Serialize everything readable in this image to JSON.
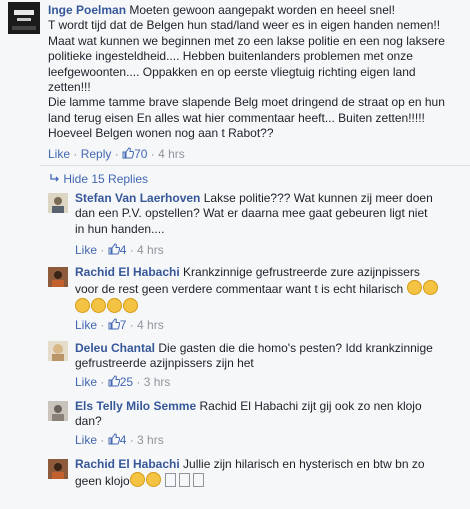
{
  "main_comment": {
    "author": "Inge Poelman",
    "lines": [
      "Moeten gewoon aangepakt worden en heeel snel!",
      "T wordt tijd dat de Belgen hun stad/land weer es in eigen handen nemen!!",
      "Maat wat kunnen we beginnen met zo een lakse politie en een nog laksere",
      "politieke ingesteldheid.... Hebben buitenlanders problemen met onze",
      "leefgewoonten.... Oppakken en op eerste vliegtuig richting eigen land",
      "zetten!!!",
      "Die lamme tamme brave slapende Belg moet dringend de straat op en hun",
      "land terug eisen En alles wat hier commentaar heeft... Buiten zetten!!!!!",
      "Hoeveel Belgen wonen nog aan t Rabot??"
    ],
    "like": "Like",
    "reply": "Reply",
    "likes": "70",
    "time": "4 hrs",
    "dot": "·"
  },
  "hide_replies": "Hide 15 Replies",
  "replies": [
    {
      "author": "Stefan Van Laerhoven",
      "lines": [
        "Lakse politie??? Wat kunnen zij meer doen",
        "dan een P.V. opstellen? Wat er daarna mee gaat gebeuren ligt niet",
        "in hun handen...."
      ],
      "like": "Like",
      "likes": "4",
      "time": "4 hrs"
    },
    {
      "author": "Rachid El Habachi",
      "lines": [
        "Krankzinnige gefrustreerde zure azijnpissers",
        "voor de rest geen verdere commentaar want t is echt hilarisch"
      ],
      "like": "Like",
      "likes": "7",
      "time": "4 hrs"
    },
    {
      "author": "Deleu Chantal",
      "lines": [
        "Die gasten die die homo's pesten? Idd krankzinnige",
        "gefrustreerde azijnpissers zijn het"
      ],
      "like": "Like",
      "likes": "25",
      "time": "3 hrs"
    },
    {
      "author": "Els Telly Milo Semme",
      "lines": [
        "Rachid El Habachi zijt gij ook zo nen klojo",
        "dan?"
      ],
      "like": "Like",
      "likes": "4",
      "time": "3 hrs"
    },
    {
      "author": "Rachid El Habachi",
      "lines": [
        "Jullie zijn hilarisch en hysterisch en btw bn zo",
        "geen klojo"
      ],
      "like": "Like",
      "likes": "",
      "time": ""
    }
  ],
  "colors": {
    "link": "#365899",
    "meta": "#90949c",
    "action": "#4267b2",
    "bg": "#f6f7f9"
  }
}
